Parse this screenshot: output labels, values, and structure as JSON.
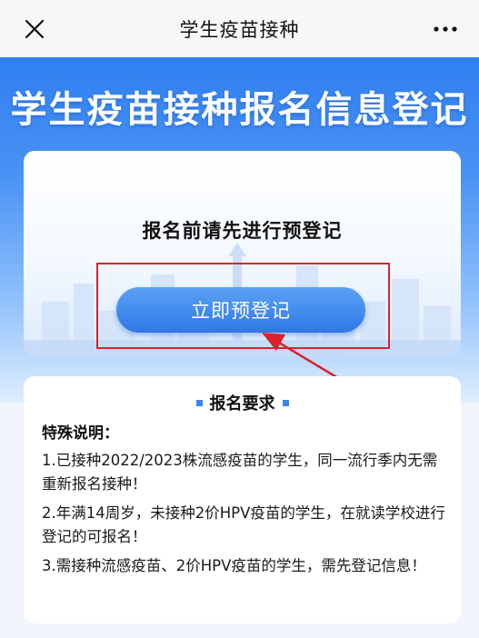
{
  "topbar": {
    "title": "学生疫苗接种"
  },
  "hero": {
    "title": "学生疫苗接种报名信息登记"
  },
  "register_card": {
    "prompt": "报名前请先进行预登记",
    "button_label": "立即预登记"
  },
  "requirements": {
    "title": "报名要求",
    "special_label": "特殊说明：",
    "items": [
      "1.已接种2022/2023株流感疫苗的学生，同一流行季内无需重新报名接种！",
      "2.年满14周岁，未接种2价HPV疫苗的学生，在就读学校进行登记的可报名！",
      "3.需接种流感疫苗、2价HPV疫苗的学生，需先登记信息！"
    ]
  },
  "colors": {
    "brand_blue": "#2f7ff0",
    "highlight_red": "#d9232d"
  },
  "icons": {
    "close": "close-icon",
    "more": "more-icon"
  }
}
